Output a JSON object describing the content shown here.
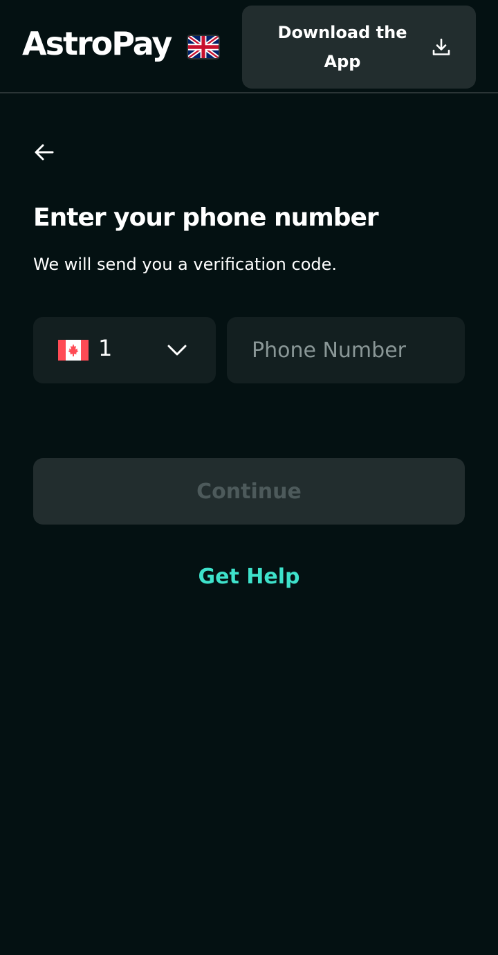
{
  "header": {
    "logo_text": "AstroPay",
    "language_flag_icon": "uk-flag-icon",
    "download_label": "Download the App",
    "download_icon": "download-icon"
  },
  "nav": {
    "back_icon": "arrow-left-icon"
  },
  "main": {
    "title": "Enter your phone number",
    "subtitle": "We will send you a verification code.",
    "country_select": {
      "flag_icon": "canada-flag-icon",
      "selected_code": "1",
      "chevron_icon": "chevron-down-icon"
    },
    "phone_input": {
      "value": "",
      "placeholder": "Phone Number"
    },
    "continue_label": "Continue",
    "help_label": "Get Help"
  },
  "colors": {
    "background": "#041112",
    "panel": "#131f20",
    "button_disabled": "#222d2e",
    "button_disabled_text": "#4d5a5b",
    "accent": "#3ee2cb",
    "placeholder": "#8a9797"
  }
}
